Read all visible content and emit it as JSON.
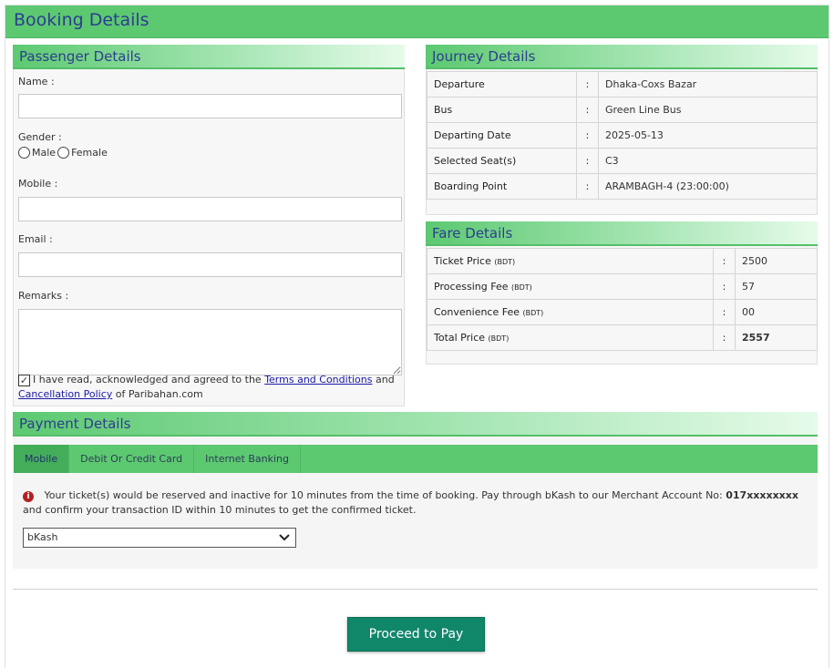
{
  "page": {
    "title": "Booking Details"
  },
  "passenger": {
    "heading": "Passenger Details",
    "name_label": "Name :",
    "gender_label": "Gender :",
    "gender_male": "Male",
    "gender_female": "Female",
    "mobile_label": "Mobile :",
    "email_label": "Email :",
    "remarks_label": "Remarks :",
    "terms_prefix": "I have read, acknowledged and agreed to the",
    "terms_link": "Terms and Conditions",
    "terms_and": "and",
    "cancellation_link": "Cancellation Policy",
    "terms_suffix": "of Paribahan.com",
    "agreed": true
  },
  "journey": {
    "heading": "Journey Details",
    "rows": [
      {
        "label": "Departure",
        "sep": ":",
        "value": "Dhaka-Coxs Bazar"
      },
      {
        "label": "Bus",
        "sep": ":",
        "value": "Green Line Bus"
      },
      {
        "label": "Departing Date",
        "sep": ":",
        "value": "2025-05-13"
      },
      {
        "label": "Selected Seat(s)",
        "sep": ":",
        "value": "C3"
      },
      {
        "label": "Boarding Point",
        "sep": ":",
        "value": "ARAMBAGH-4 (23:00:00)"
      }
    ]
  },
  "fare": {
    "heading": "Fare Details",
    "unit": "(BDT)",
    "rows": [
      {
        "label": "Ticket Price",
        "sep": ":",
        "value": "2500"
      },
      {
        "label": "Processing Fee",
        "sep": ":",
        "value": "57"
      },
      {
        "label": "Convenience Fee",
        "sep": ":",
        "value": "00"
      },
      {
        "label": "Total Price",
        "sep": ":",
        "value": "2557"
      }
    ]
  },
  "payment": {
    "heading": "Payment Details",
    "tabs": [
      {
        "label": "Mobile",
        "active": true
      },
      {
        "label": "Debit Or Credit Card",
        "active": false
      },
      {
        "label": "Internet Banking",
        "active": false
      }
    ],
    "notice_text": "Your ticket(s) would be reserved and inactive for 10 minutes from the time of booking. Pay through bKash to our Merchant Account No:",
    "merchant_account": "017xxxxxxxx",
    "notice_suffix": "and confirm your transaction ID within 10 minutes to get the confirmed ticket.",
    "method_selected": "bKash"
  },
  "actions": {
    "proceed_label": "Proceed to Pay"
  },
  "colors": {
    "header_green": "#5cc971",
    "heading_text": "#2d3d8f",
    "button": "#11876a",
    "link": "#1a1aa6"
  }
}
